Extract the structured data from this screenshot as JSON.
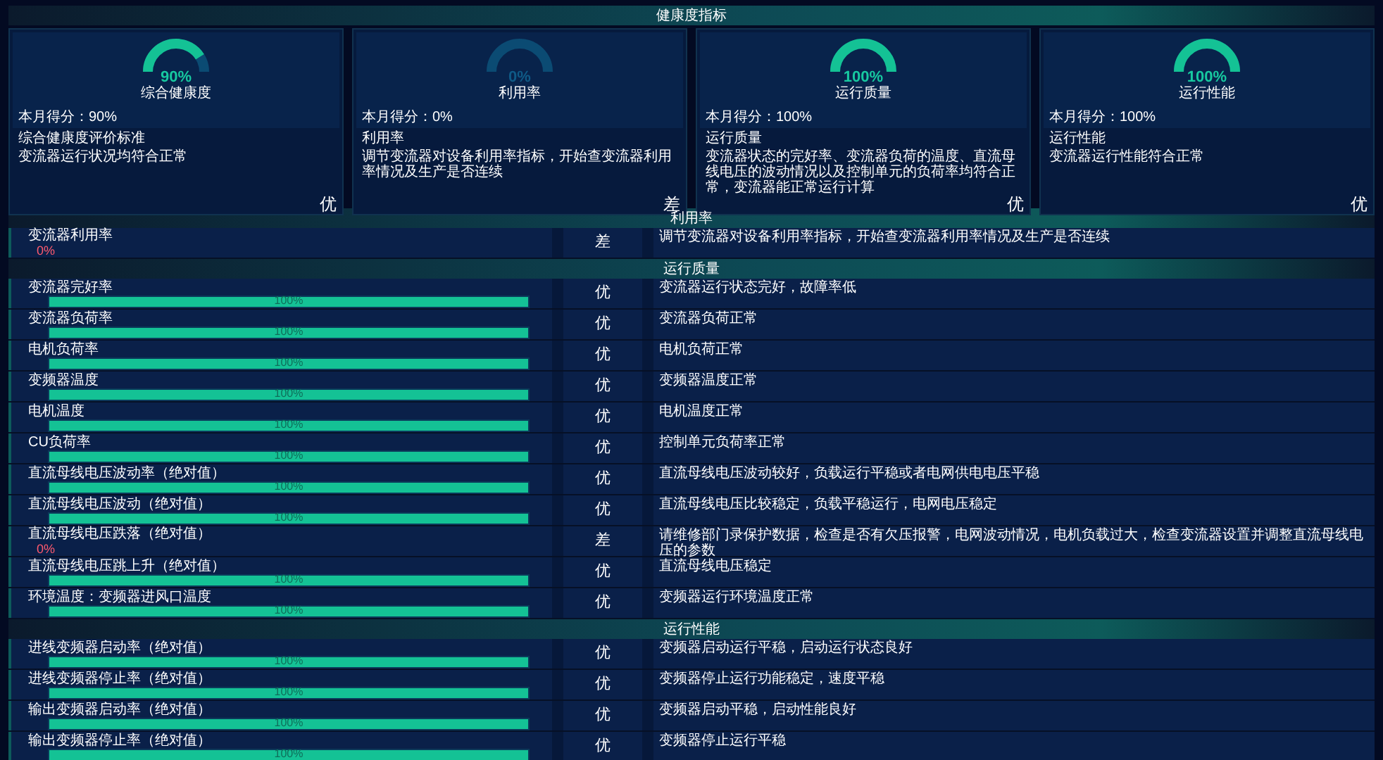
{
  "title": "健康度指标",
  "cards": [
    {
      "gauge": {
        "kind": "partial",
        "reading": "90%",
        "label": "综合健康度"
      },
      "score": "本月得分：90%",
      "heading": "综合健康度评价标准",
      "description": "变流器运行状况均符合正常",
      "grade": "优"
    },
    {
      "gauge": {
        "kind": "empty",
        "reading": "0%",
        "label": "利用率"
      },
      "score": "本月得分：0%",
      "heading": "利用率",
      "description": "调节变流器对设备利用率指标，开始查变流器利用率情况及生产是否连续",
      "grade": "差"
    },
    {
      "gauge": {
        "kind": "full",
        "reading": "100%",
        "label": "运行质量"
      },
      "score": "本月得分：100%",
      "heading": "运行质量",
      "description": "变流器状态的完好率、变流器负荷的温度、直流母线电压的波动情况以及控制单元的负荷率均符合正常，变流器能正常运行计算",
      "grade": "优"
    },
    {
      "gauge": {
        "kind": "full",
        "reading": "100%",
        "label": "运行性能"
      },
      "score": "本月得分：100%",
      "heading": "运行性能",
      "description": "变流器运行性能符合正常",
      "grade": "优"
    }
  ],
  "sections": [
    {
      "title": "利用率",
      "rows": [
        {
          "kind": "value",
          "label": "变流器利用率",
          "reading": "0%",
          "grade": "差",
          "description": "调节变流器对设备利用率指标，开始查变流器利用率情况及生产是否连续"
        }
      ]
    },
    {
      "title": "运行质量",
      "rows": [
        {
          "kind": "bar",
          "label": "变流器完好率",
          "level": 1,
          "reading": "100%",
          "grade": "优",
          "description": "变流器运行状态完好，故障率低"
        },
        {
          "kind": "bar",
          "label": "变流器负荷率",
          "level": 1,
          "reading": "100%",
          "grade": "优",
          "description": "变流器负荷正常"
        },
        {
          "kind": "bar",
          "label": "电机负荷率",
          "level": 1,
          "reading": "100%",
          "grade": "优",
          "description": "电机负荷正常"
        },
        {
          "kind": "bar",
          "label": "变频器温度",
          "level": 1,
          "reading": "100%",
          "grade": "优",
          "description": "变频器温度正常"
        },
        {
          "kind": "bar",
          "label": "电机温度",
          "level": 1,
          "reading": "100%",
          "grade": "优",
          "description": "电机温度正常"
        },
        {
          "kind": "bar",
          "label": "CU负荷率",
          "level": 1,
          "reading": "100%",
          "grade": "优",
          "description": "控制单元负荷率正常"
        },
        {
          "kind": "bar",
          "label": "直流母线电压波动率（绝对值）",
          "level": 1,
          "reading": "100%",
          "grade": "优",
          "description": "直流母线电压波动较好，负载运行平稳或者电网供电电压平稳"
        },
        {
          "kind": "bar",
          "label": "直流母线电压波动（绝对值）",
          "level": 1,
          "reading": "100%",
          "grade": "优",
          "description": "直流母线电压比较稳定，负载平稳运行，电网电压稳定"
        },
        {
          "kind": "value",
          "label": "直流母线电压跌落（绝对值）",
          "reading": "0%",
          "grade": "差",
          "description": "请维修部门录保护数据，检查是否有欠压报警，电网波动情况，电机负载过大，检查变流器设置并调整直流母线电压的参数"
        },
        {
          "kind": "bar",
          "label": "直流母线电压跳上升（绝对值）",
          "level": 1,
          "reading": "100%",
          "grade": "优",
          "description": "直流母线电压稳定"
        },
        {
          "kind": "bar",
          "label": "环境温度：变频器进风口温度",
          "level": 1,
          "reading": "100%",
          "grade": "优",
          "description": "变频器运行环境温度正常"
        }
      ]
    },
    {
      "title": "运行性能",
      "rows": [
        {
          "kind": "bar",
          "label": "进线变频器启动率（绝对值）",
          "level": 1,
          "reading": "100%",
          "grade": "优",
          "description": "变频器启动运行平稳，启动运行状态良好"
        },
        {
          "kind": "bar",
          "label": "进线变频器停止率（绝对值）",
          "level": 1,
          "reading": "100%",
          "grade": "优",
          "description": "变频器停止运行功能稳定，速度平稳"
        },
        {
          "kind": "bar",
          "label": "输出变频器启动率（绝对值）",
          "level": 1,
          "reading": "100%",
          "grade": "优",
          "description": "变频器启动平稳，启动性能良好"
        },
        {
          "kind": "bar",
          "label": "输出变频器停止率（绝对值）",
          "level": 1,
          "reading": "100%",
          "grade": "优",
          "description": "变频器停止运行平稳"
        }
      ]
    }
  ]
}
